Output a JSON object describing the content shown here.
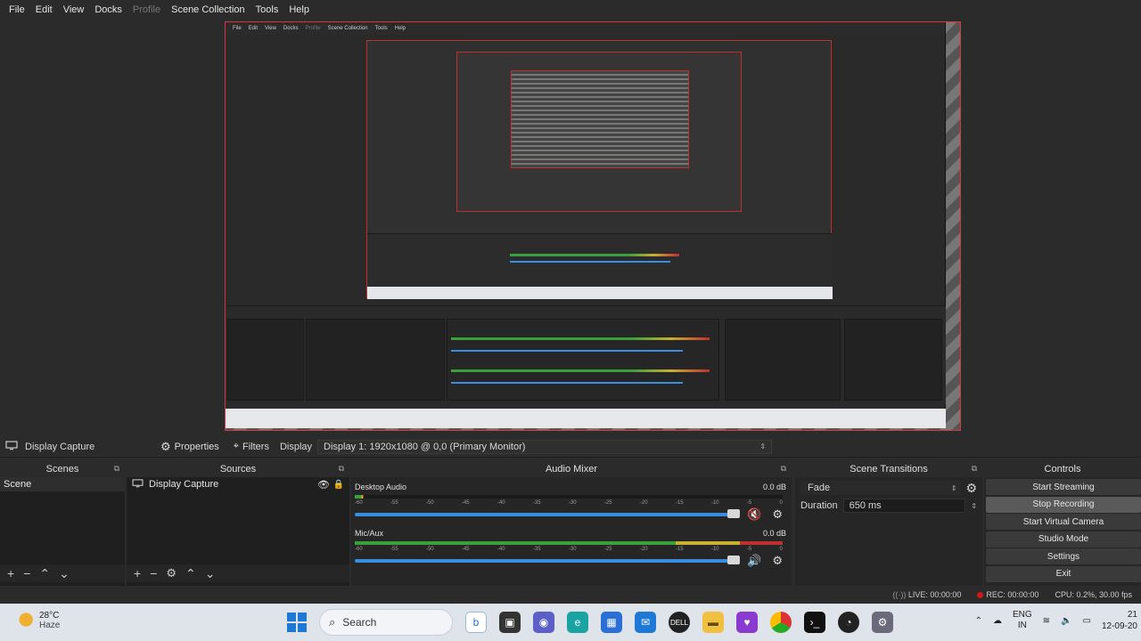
{
  "menu": [
    {
      "label": "File",
      "enabled": true
    },
    {
      "label": "Edit",
      "enabled": true
    },
    {
      "label": "View",
      "enabled": true
    },
    {
      "label": "Docks",
      "enabled": true
    },
    {
      "label": "Profile",
      "enabled": false
    },
    {
      "label": "Scene Collection",
      "enabled": true
    },
    {
      "label": "Tools",
      "enabled": true
    },
    {
      "label": "Help",
      "enabled": true
    }
  ],
  "context": {
    "source_name": "Display Capture",
    "properties": "Properties",
    "filters": "Filters",
    "display_label": "Display",
    "display_value": "Display 1: 1920x1080 @ 0,0 (Primary Monitor)"
  },
  "scenes": {
    "title": "Scenes",
    "items": [
      "Scene"
    ]
  },
  "sources": {
    "title": "Sources",
    "items": [
      "Display Capture"
    ]
  },
  "mixer": {
    "title": "Audio Mixer",
    "ticks": [
      "-60",
      "-55",
      "-50",
      "-45",
      "-40",
      "-35",
      "-30",
      "-25",
      "-20",
      "-15",
      "-10",
      "-5",
      "0"
    ],
    "channels": [
      {
        "name": "Desktop Audio",
        "db": "0.0 dB",
        "muted": true
      },
      {
        "name": "Mic/Aux",
        "db": "0.0 dB",
        "muted": false
      }
    ]
  },
  "transitions": {
    "title": "Scene Transitions",
    "type": "Fade",
    "duration_label": "Duration",
    "duration": "650 ms"
  },
  "controls": {
    "title": "Controls",
    "start_streaming": "Start Streaming",
    "stop_recording": "Stop Recording",
    "start_virtual_camera": "Start Virtual Camera",
    "studio_mode": "Studio Mode",
    "settings": "Settings",
    "exit": "Exit"
  },
  "status": {
    "live": "LIVE: 00:00:00",
    "rec": "REC: 00:00:00",
    "cpu": "CPU: 0.2%, 30.00 fps"
  },
  "taskbar": {
    "temp": "28°C",
    "weather": "Haze",
    "search_placeholder": "Search",
    "lang": "ENG",
    "region": "IN",
    "time": "21",
    "date": "12-09-20"
  },
  "colors": {
    "recording": "#d01818",
    "accent_blue": "#3a8ee0",
    "preview_border": "#d43a3a"
  }
}
